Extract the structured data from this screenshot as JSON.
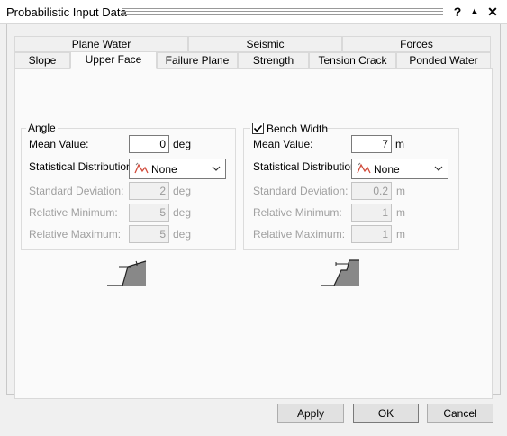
{
  "window": {
    "title": "Probabilistic Input Data",
    "help_glyph": "?",
    "collapse_glyph": "▲",
    "close_glyph": "✕"
  },
  "tabs": {
    "row1": [
      "Plane Water",
      "Seismic",
      "Forces"
    ],
    "row2": [
      "Slope",
      "Upper Face",
      "Failure Plane",
      "Strength",
      "Tension Crack",
      "Ponded Water"
    ],
    "active": "Upper Face"
  },
  "angle": {
    "title": "Angle",
    "mean_label": "Mean Value:",
    "mean_value": "0",
    "mean_unit": "deg",
    "dist_label": "Statistical Distribution:",
    "dist_value": "None",
    "std_label": "Standard Deviation:",
    "std_value": "2",
    "std_unit": "deg",
    "relmin_label": "Relative Minimum:",
    "relmin_value": "5",
    "relmin_unit": "deg",
    "relmax_label": "Relative Maximum:",
    "relmax_value": "5",
    "relmax_unit": "deg"
  },
  "bench": {
    "title": "Bench Width",
    "checked": true,
    "mean_label": "Mean Value:",
    "mean_value": "7",
    "mean_unit": "m",
    "dist_label": "Statistical Distribution:",
    "dist_value": "None",
    "std_label": "Standard Deviation:",
    "std_value": "0.2",
    "std_unit": "m",
    "relmin_label": "Relative Minimum:",
    "relmin_value": "1",
    "relmin_unit": "m",
    "relmax_label": "Relative Maximum:",
    "relmax_value": "1",
    "relmax_unit": "m"
  },
  "buttons": {
    "apply": "Apply",
    "ok": "OK",
    "cancel": "Cancel"
  },
  "icons": {
    "distribution": "distribution-curve-icon",
    "angle_diagram": "upper-face-angle-diagram",
    "bench_diagram": "bench-width-diagram"
  }
}
